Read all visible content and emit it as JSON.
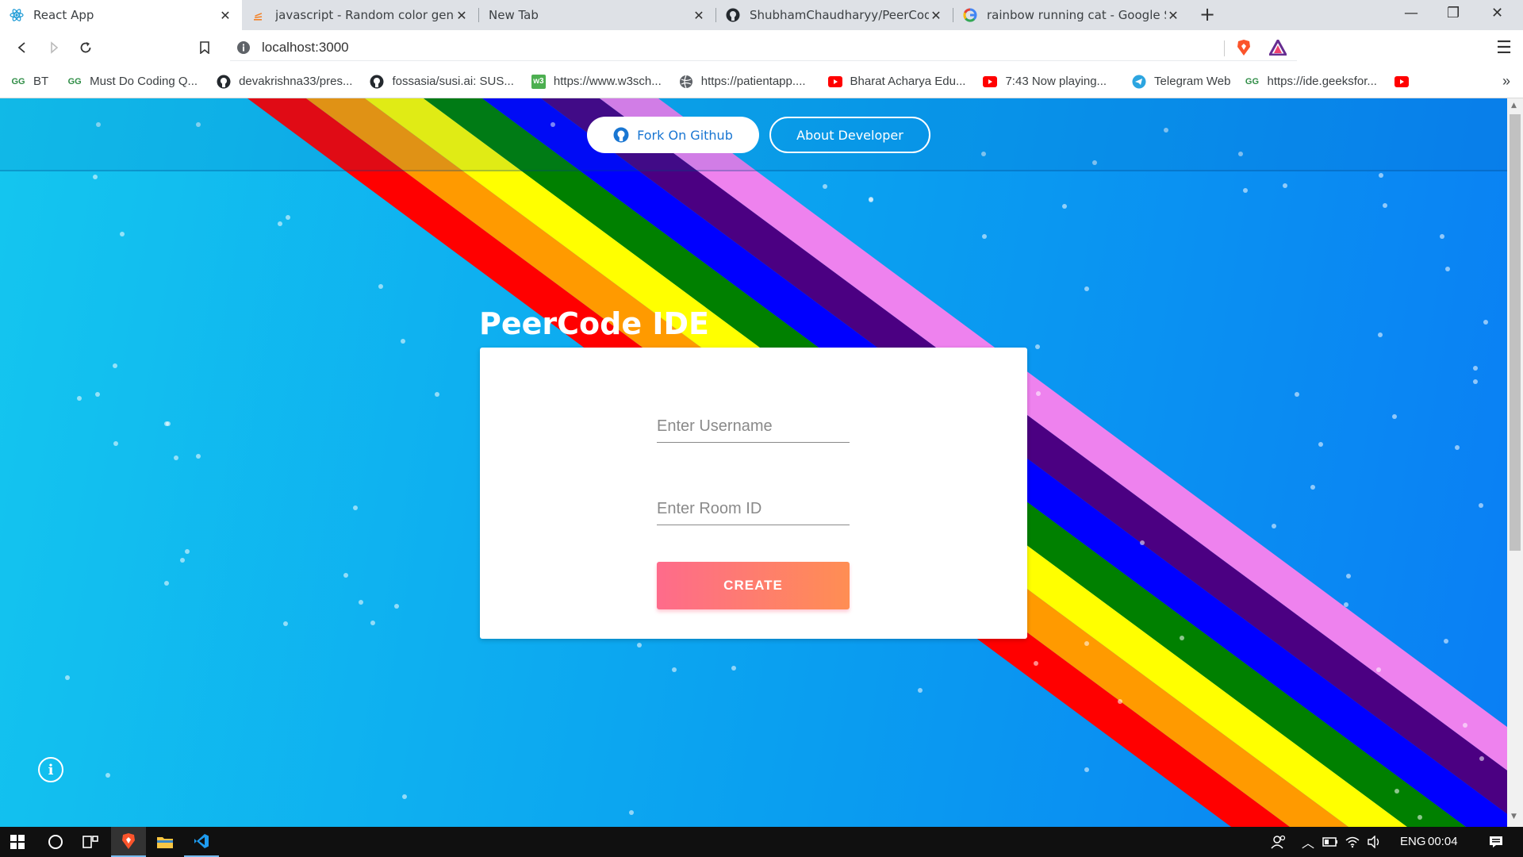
{
  "browser": {
    "tabs": [
      {
        "label": "React App",
        "icon": "react-icon",
        "active": true
      },
      {
        "label": "javascript - Random color generat",
        "icon": "stackoverflow-icon",
        "active": false
      },
      {
        "label": "New Tab",
        "icon": "",
        "active": false
      },
      {
        "label": "ShubhamChaudharyy/PeerCode-I",
        "icon": "github-icon",
        "active": false
      },
      {
        "label": "rainbow running cat - Google Sear",
        "icon": "google-icon",
        "active": false
      }
    ],
    "new_tab_label": "+",
    "url": "localhost:3000",
    "bookmarks": [
      {
        "label": "BT",
        "icon": "geeksforgeeks-icon"
      },
      {
        "label": "Must Do Coding Q...",
        "icon": "geeksforgeeks-icon"
      },
      {
        "label": "devakrishna33/pres...",
        "icon": "github-icon"
      },
      {
        "label": "fossasia/susi.ai: SUS...",
        "icon": "github-icon"
      },
      {
        "label": "https://www.w3sch...",
        "icon": "w3schools-icon"
      },
      {
        "label": "https://patientapp....",
        "icon": "globe-icon"
      },
      {
        "label": "Bharat Acharya Edu...",
        "icon": "youtube-icon"
      },
      {
        "label": "7:43 Now playing...",
        "icon": "youtube-icon"
      },
      {
        "label": "Telegram Web",
        "icon": "telegram-icon"
      },
      {
        "label": "https://ide.geeksfor...",
        "icon": "geeksforgeeks-icon"
      }
    ],
    "overflow_label": "»"
  },
  "page": {
    "github_button_label": "Fork On Github",
    "about_button_label": "About Developer",
    "title": "PeerCode IDE",
    "username_placeholder": "Enter Username",
    "room_placeholder": "Enter Room ID",
    "create_label": "CREATE",
    "rainbow_colors": [
      "#ff0000",
      "#ff9a00",
      "#ffff00",
      "#008000",
      "#0000ff",
      "#4b0082",
      "#ee82ee"
    ]
  },
  "taskbar": {
    "language": "ENG",
    "time": "00:04"
  }
}
